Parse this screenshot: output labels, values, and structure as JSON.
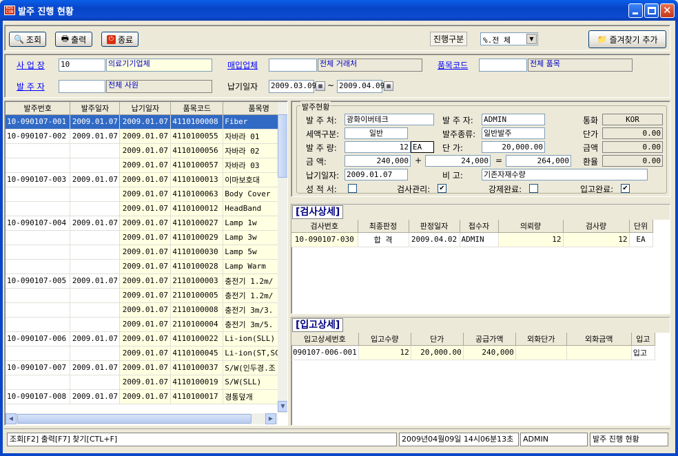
{
  "window": {
    "title": "발주 진행 현황",
    "icon_text": "KDS\nCON"
  },
  "toolbar": {
    "query": "조회",
    "print": "출력",
    "exit": "종료",
    "progress_label": "진행구분",
    "progress_value": "%.전   체",
    "favorite": "즐겨찾기 추가"
  },
  "filter": {
    "biz_label": "사 업 장",
    "biz_code": "10",
    "biz_name": "의료기기업체",
    "vendor_label": "매입업체",
    "vendor_code": "",
    "vendor_name": "전체 거래처",
    "item_label": "품목코드",
    "item_code": "",
    "item_name": "전체 품목",
    "orderer_label": "발 주 자",
    "orderer_code": "",
    "orderer_name": "전체 사원",
    "due_label": "납기일자",
    "due_from": "2009.03.09",
    "due_to": "2009.04.09",
    "tilde": "~"
  },
  "orders": {
    "columns": [
      "발주번호",
      "발주일자",
      "납기일자",
      "품목코드",
      "품목명"
    ],
    "rows": [
      [
        "10-090107-001",
        "2009.01.07",
        "2009.01.07",
        "4110100008",
        "Fiber"
      ],
      [
        "10-090107-002",
        "2009.01.07",
        "2009.01.07",
        "4110100055",
        "자바라 01"
      ],
      [
        "",
        "",
        "2009.01.07",
        "4110100056",
        "자바라 02"
      ],
      [
        "",
        "",
        "2009.01.07",
        "4110100057",
        "자바라 03"
      ],
      [
        "10-090107-003",
        "2009.01.07",
        "2009.01.07",
        "4110100013",
        "이마보호대"
      ],
      [
        "",
        "",
        "2009.01.07",
        "4110100063",
        "Body Cover"
      ],
      [
        "",
        "",
        "2009.01.07",
        "4110100012",
        "HeadBand"
      ],
      [
        "10-090107-004",
        "2009.01.07",
        "2009.01.07",
        "4110100027",
        "Lamp 1w"
      ],
      [
        "",
        "",
        "2009.01.07",
        "4110100029",
        "Lamp 3w"
      ],
      [
        "",
        "",
        "2009.01.07",
        "4110100030",
        "Lamp 5w"
      ],
      [
        "",
        "",
        "2009.01.07",
        "4110100028",
        "Lamp Warm"
      ],
      [
        "10-090107-005",
        "2009.01.07",
        "2009.01.07",
        "2110100003",
        "충전기 1.2m/"
      ],
      [
        "",
        "",
        "2009.01.07",
        "2110100005",
        "충전기 1.2m/"
      ],
      [
        "",
        "",
        "2009.01.07",
        "2110100008",
        "충전기 3m/3."
      ],
      [
        "",
        "",
        "2009.01.07",
        "2110100004",
        "충전기 3m/5."
      ],
      [
        "10-090107-006",
        "2009.01.07",
        "2009.01.07",
        "4110100022",
        "Li-ion(SLL)"
      ],
      [
        "",
        "",
        "2009.01.07",
        "4110100045",
        "Li-ion(ST,SC"
      ],
      [
        "10-090107-007",
        "2009.01.07",
        "2009.01.07",
        "4110100037",
        "S/W(인두경.조"
      ],
      [
        "",
        "",
        "2009.01.07",
        "4110100019",
        "S/W(SLL)"
      ],
      [
        "10-090107-008",
        "2009.01.07",
        "2009.01.07",
        "4110100017",
        "경통덮개"
      ]
    ]
  },
  "detail": {
    "group": "발주현황",
    "vendor_label": "발 주 처:",
    "vendor": "광화이버테크",
    "orderer_label": "발 주 자:",
    "orderer": "ADMIN",
    "currency_label": "통화",
    "currency": "KOR",
    "tax_label": "세액구분:",
    "tax": "일반",
    "kind_label": "발주종류:",
    "kind": "일반발주",
    "unit_price_label": "단가",
    "unit_price": "0.00",
    "qty_label": "발 주 량:",
    "qty": "12",
    "qty_unit": "EA",
    "price_label": "단    가:",
    "price": "20,000.00",
    "amount_label": "금액",
    "amount": "0.00",
    "sum_label": "금    액:",
    "sum1": "240,000",
    "plus": "+",
    "sum2": "24,000",
    "eq": "=",
    "total": "264,000",
    "rate_label": "환율",
    "rate": "0.00",
    "due_label": "납기일자:",
    "due": "2009.01.07",
    "note_label": "비    고:",
    "note": "기존자재수량",
    "cert_label": "성 적 서:",
    "cert": "",
    "insp_label": "검사관리:",
    "insp": "✔",
    "forced_label": "강제완료:",
    "forced": "",
    "recv_label": "입고완료:",
    "recv": "✔"
  },
  "inspection": {
    "title": "[검사상세]",
    "columns": [
      "검사번호",
      "최종판정",
      "판정일자",
      "접수자",
      "의뢰량",
      "검사량",
      "단위"
    ],
    "rows": [
      [
        "10-090107-030",
        "합  격",
        "2009.04.02",
        "ADMIN",
        "12",
        "12",
        "EA"
      ]
    ]
  },
  "receiving": {
    "title": "[입고상세]",
    "columns": [
      "입고상세번호",
      "입고수량",
      "단가",
      "공급가액",
      "외화단가",
      "외화금액",
      "입고"
    ],
    "rows": [
      [
        "090107-006-001",
        "12",
        "20,000.00",
        "240,000",
        "",
        "",
        "입고"
      ]
    ]
  },
  "statusbar": {
    "hint": "조회[F2] 출력[F7] 찾기[CTL+F]",
    "datetime": "2009년04월09일 14시06분13초",
    "user": "ADMIN",
    "screen": "발주 진행 현황"
  }
}
